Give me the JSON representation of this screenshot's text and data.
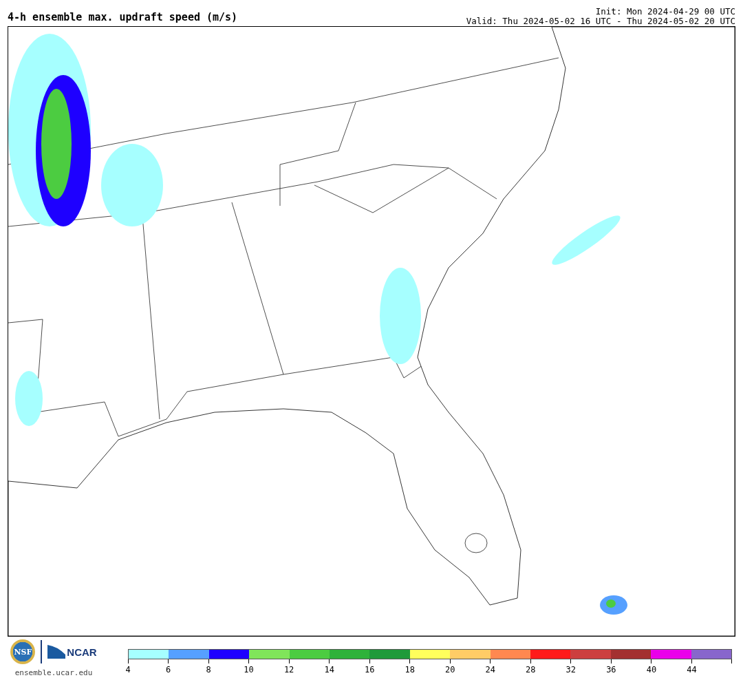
{
  "header": {
    "title": "4-h ensemble max. updraft speed (m/s)",
    "init": "Init: Mon 2024-04-29 00 UTC",
    "valid": "Valid: Thu 2024-05-02 16 UTC - Thu 2024-05-02 20 UTC"
  },
  "footer": {
    "logos": [
      "NSF",
      "NCAR"
    ],
    "url": "ensemble.ucar.edu"
  },
  "legend": {
    "bins": [
      {
        "color": "#a6ffff"
      },
      {
        "color": "#56a0ff"
      },
      {
        "color": "#1e00ff"
      },
      {
        "color": "#80e55a"
      },
      {
        "color": "#4ccc41"
      },
      {
        "color": "#2eb23a"
      },
      {
        "color": "#1f9a3a"
      },
      {
        "color": "#ffff5c"
      },
      {
        "color": "#ffcc66"
      },
      {
        "color": "#ff8850"
      },
      {
        "color": "#ff1a1a"
      },
      {
        "color": "#cc3f3f"
      },
      {
        "color": "#a33030"
      },
      {
        "color": "#ea00ea"
      },
      {
        "color": "#8866cc"
      }
    ],
    "ticks": [
      "4",
      "6",
      "8",
      "10",
      "12",
      "14",
      "16",
      "18",
      "20",
      "24",
      "28",
      "32",
      "36",
      "40",
      "44"
    ]
  }
}
